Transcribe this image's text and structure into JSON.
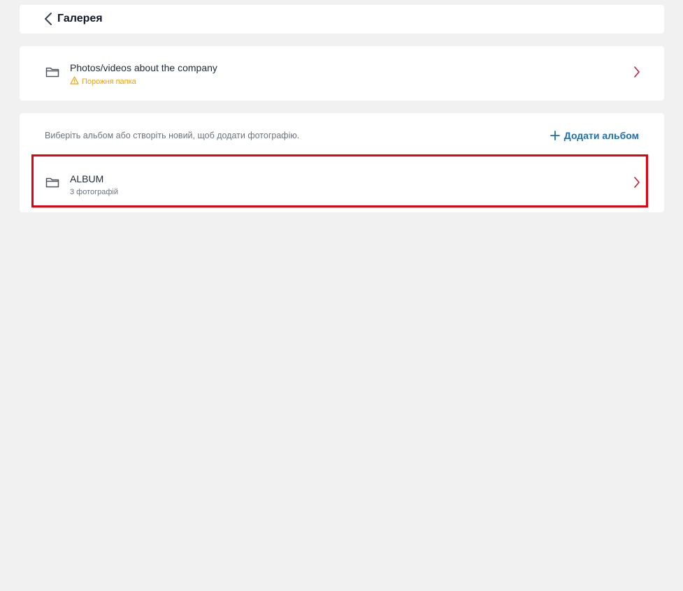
{
  "header": {
    "back_icon": "chevron-left-icon",
    "title": "Галерея"
  },
  "folder": {
    "icon": "folder-icon",
    "title": "Photos/videos about the company",
    "status_icon": "warning-icon",
    "status": "Порожня папка",
    "chevron_icon": "chevron-right-icon"
  },
  "albums": {
    "hint": "Виберіть альбом або створіть новий, щоб додати фотографію.",
    "add_icon": "plus-icon",
    "add_label": "Додати альбом",
    "items": [
      {
        "icon": "folder-icon",
        "title": "ALBUM",
        "subtitle": "3 фотографій",
        "chevron_icon": "chevron-right-icon",
        "highlighted": true
      }
    ]
  },
  "colors": {
    "background": "#f1f1f1",
    "card": "#ffffff",
    "accent": "#1a6fb5",
    "chevron": "#c0203a",
    "warning": "#f59e0b",
    "highlight": "#e3000f",
    "muted_text": "#6b7280"
  }
}
